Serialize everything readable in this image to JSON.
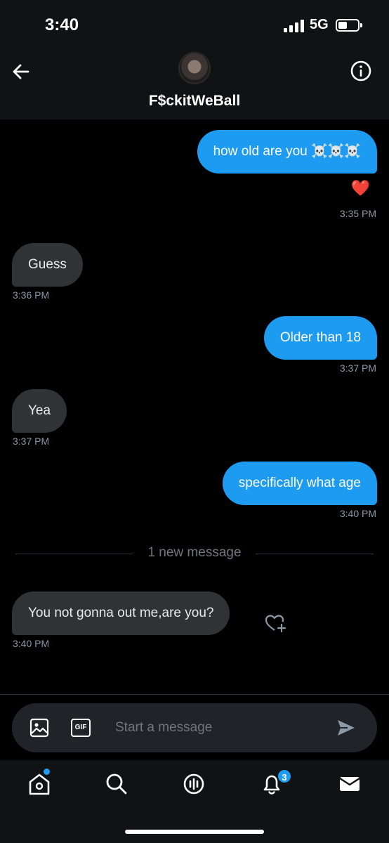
{
  "status_bar": {
    "time": "3:40",
    "network": "5G"
  },
  "header": {
    "title": "F$ckitWeBall",
    "back_icon": "back-arrow-icon",
    "info_icon": "info-icon"
  },
  "messages": [
    {
      "text": "how old are you ☠️☠️☠️",
      "time": "3:35 PM",
      "direction": "sent",
      "reaction": "❤️"
    },
    {
      "text": "Guess",
      "time": "3:36 PM",
      "direction": "received"
    },
    {
      "text": "Older than 18",
      "time": "3:37 PM",
      "direction": "sent"
    },
    {
      "text": "Yea",
      "time": "3:37 PM",
      "direction": "received"
    },
    {
      "text": "specifically what age",
      "time": "3:40 PM",
      "direction": "sent"
    },
    {
      "text": "You not gonna out me,are you?",
      "time": "3:40 PM",
      "direction": "received"
    }
  ],
  "divider": {
    "label": "1 new message"
  },
  "composer": {
    "placeholder": "Start a message",
    "gif_label": "GIF"
  },
  "tabbar": {
    "notifications_count": "3"
  },
  "colors": {
    "accent": "#1d9bf0",
    "received_bubble": "#2f3336",
    "background": "#000000"
  }
}
